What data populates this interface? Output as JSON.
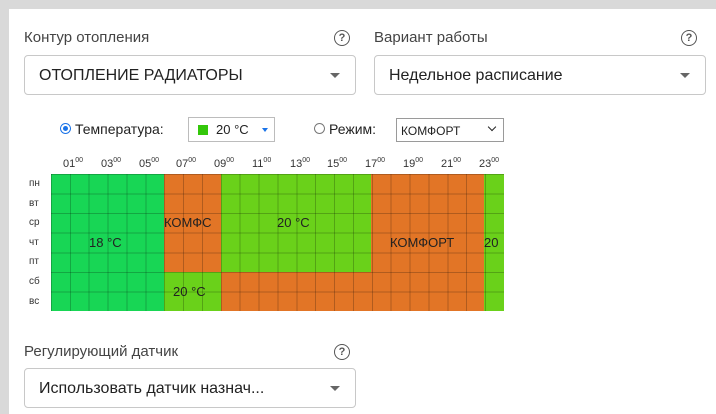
{
  "colors": {
    "accent": "#1a73e8",
    "temp_18": "#18d655",
    "temp_20": "#6ad11a",
    "comfort": "#e27526"
  },
  "circuit": {
    "label": "Контур отопления",
    "value": "ОТОПЛЕНИЕ РАДИАТОРЫ",
    "help": "?"
  },
  "mode_variant": {
    "label": "Вариант работы",
    "value": "Недельное расписание",
    "help": "?"
  },
  "temperature_option": {
    "label": "Температура:",
    "value": "20 °C",
    "selected": true
  },
  "mode_option": {
    "label": "Режим:",
    "value": "КОМФОРТ",
    "selected": false
  },
  "schedule": {
    "hours": [
      "01",
      "03",
      "05",
      "07",
      "09",
      "11",
      "13",
      "15",
      "17",
      "19",
      "21",
      "23"
    ],
    "hour_suffix": "00",
    "days": [
      "пн",
      "вт",
      "ср",
      "чт",
      "пт",
      "сб",
      "вс"
    ],
    "blocks": {
      "b1": "18 °C",
      "b2": "КОМФС",
      "b3": "20 °C",
      "b4": "КОМФОРТ",
      "b5": "20",
      "b6": "20 °C"
    }
  },
  "sensor": {
    "label": "Регулирующий датчик",
    "value": "Использовать датчик назнач...",
    "help": "?"
  }
}
